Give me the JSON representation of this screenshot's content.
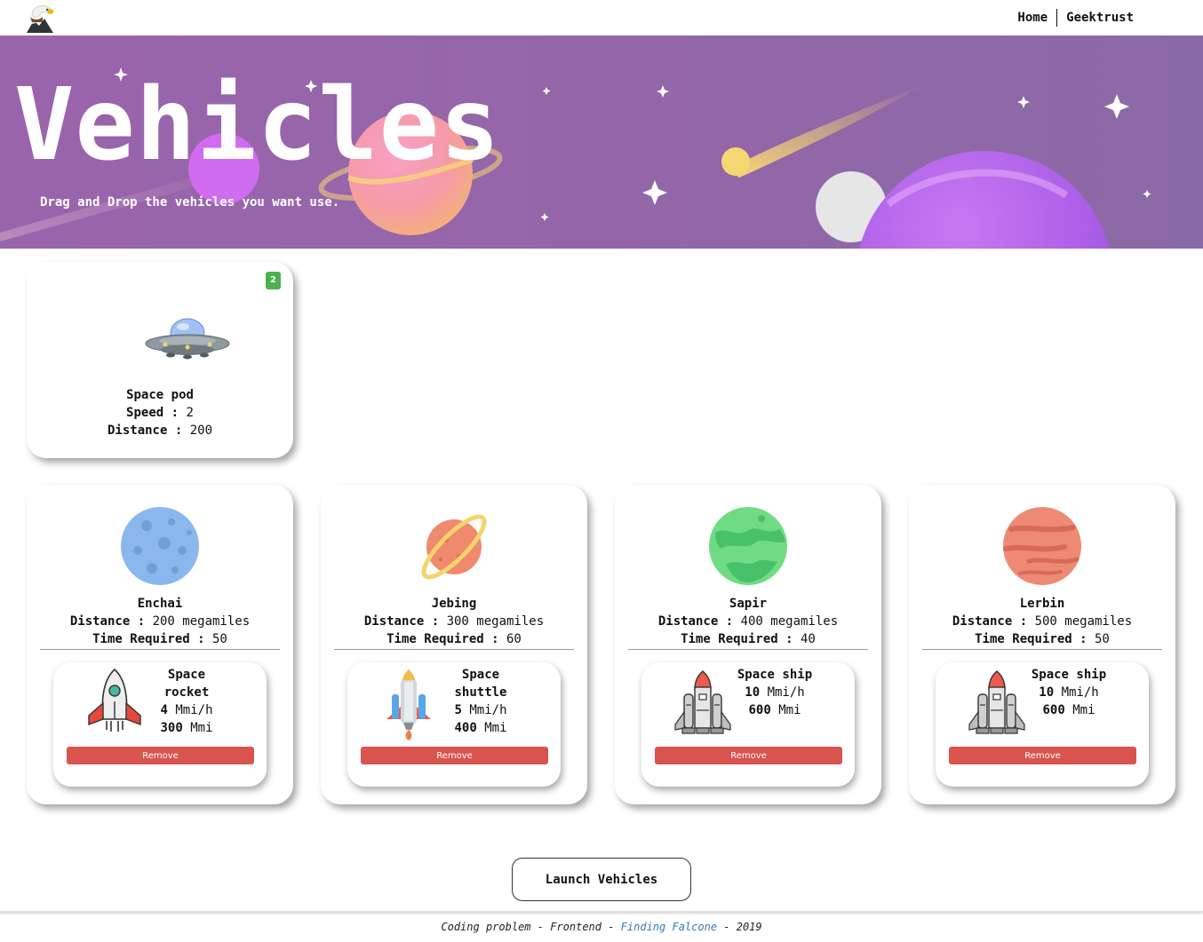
{
  "nav": {
    "home_label": "Home",
    "geektrust_label": "Geektrust"
  },
  "hero": {
    "title": "Vehicles",
    "subtitle": "Drag and Drop the vehicles you want use."
  },
  "available_vehicles": [
    {
      "name": "Space pod",
      "speed_label": "Speed :",
      "speed": "2",
      "distance_label": "Distance :",
      "distance": "200",
      "count": "2"
    }
  ],
  "planets": [
    {
      "name": "Enchai",
      "distance_label": "Distance :",
      "distance": "200 megamiles",
      "time_label": "Time Required :",
      "time": "50",
      "vehicle": {
        "name": "Space rocket",
        "speed_num": "4",
        "speed_unit": "Mmi/h",
        "dist_num": "300",
        "dist_unit": "Mmi"
      }
    },
    {
      "name": "Jebing",
      "distance_label": "Distance :",
      "distance": "300 megamiles",
      "time_label": "Time Required :",
      "time": "60",
      "vehicle": {
        "name": "Space shuttle",
        "speed_num": "5",
        "speed_unit": "Mmi/h",
        "dist_num": "400",
        "dist_unit": "Mmi"
      }
    },
    {
      "name": "Sapir",
      "distance_label": "Distance :",
      "distance": "400 megamiles",
      "time_label": "Time Required :",
      "time": "40",
      "vehicle": {
        "name": "Space ship",
        "speed_num": "10",
        "speed_unit": "Mmi/h",
        "dist_num": "600",
        "dist_unit": "Mmi"
      }
    },
    {
      "name": "Lerbin",
      "distance_label": "Distance :",
      "distance": "500 megamiles",
      "time_label": "Time Required :",
      "time": "50",
      "vehicle": {
        "name": "Space ship",
        "speed_num": "10",
        "speed_unit": "Mmi/h",
        "dist_num": "600",
        "dist_unit": "Mmi"
      }
    }
  ],
  "remove_label": "Remove",
  "launch_label": "Launch Vehicles",
  "footer": {
    "part1": "Coding problem - Frontend - ",
    "link": "Finding Falcone",
    "part2": " - 2019"
  },
  "colors": {
    "hero_bg": "#9a64ad",
    "remove_button": "#d9534f",
    "count_badge": "#4caf50",
    "link": "#337ab7"
  }
}
